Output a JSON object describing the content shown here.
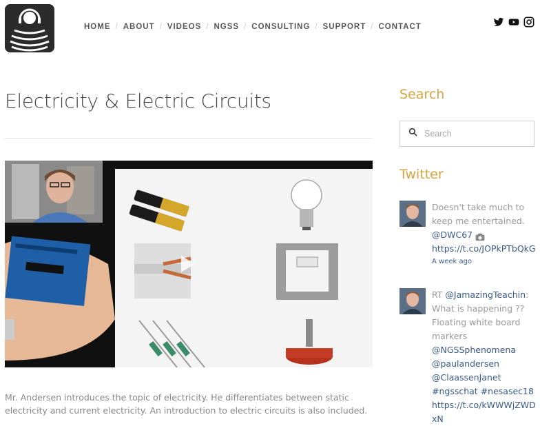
{
  "nav": {
    "items": [
      "HOME",
      "ABOUT",
      "VIDEOS",
      "NGSS",
      "CONSULTING",
      "SUPPORT",
      "CONTACT"
    ]
  },
  "social": {
    "icons": [
      "twitter-icon",
      "youtube-icon",
      "instagram-icon"
    ]
  },
  "main": {
    "title": "Electricity & Electric Circuits",
    "description": "Mr. Andersen introduces the topic of electricity. He differentiates between static electricity and current electricity. An introduction to electric circuits is also included."
  },
  "sidebar": {
    "search_heading": "Search",
    "search_placeholder": "Search",
    "twitter_heading": "Twitter",
    "tweets": [
      {
        "text": "Doesn't take much to keep me entertained.",
        "mention": "@DWC67",
        "link": "https://t.co/JOPkPTbQkG",
        "time": "A week ago"
      },
      {
        "prefix": "RT",
        "mention": "@JamazingTeachin",
        "colon": ":",
        "text": "What is happening ?? Floating white board markers",
        "m1": "@NGSSphenomena",
        "m2": "@paulandersen",
        "m3": "@ClaassenJanet",
        "h1": "#ngsschat",
        "h2": "#nesasec18",
        "link": "https://t.co/kWWWjZWDxN"
      }
    ]
  },
  "colors": {
    "accent": "#d9a441",
    "link": "#3a5a8a",
    "text": "#888888"
  }
}
